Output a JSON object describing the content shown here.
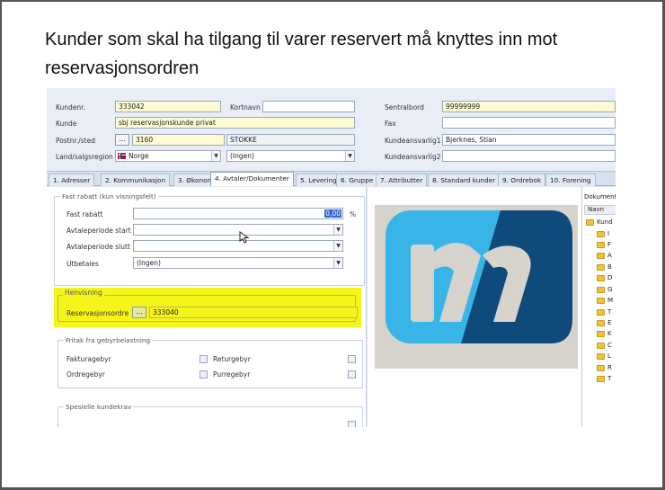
{
  "slide": {
    "title": "Kunder som skal ha tilgang til varer reservert må knyttes inn mot reservasjonsordren"
  },
  "form": {
    "kundenr_label": "Kundenr.",
    "kundenr_value": "333042",
    "kortnavn_label": "Kortnavn",
    "kortnavn_value": "",
    "kunde_label": "Kunde",
    "kunde_value": "sbj reservasjonskunde privat",
    "postnr_label": "Postnr./sted",
    "postnr_button": "...",
    "postnr_value": "3160",
    "sted_value": "STOKKE",
    "land_label": "Land/salgsregion",
    "land_value": "Norge",
    "region_value": "(Ingen)",
    "sentralbord_label": "Sentralbord",
    "sentralbord_value": "99999999",
    "fax_label": "Fax",
    "fax_value": "",
    "kundeansvarlig1_label": "Kundeansvarlig1",
    "kundeansvarlig1_value": "Bjerknes, Stian",
    "kundeansvarlig2_label": "Kundeansvarlig2",
    "kundeansvarlig2_value": ""
  },
  "tabs": [
    {
      "label": "1. Adresser"
    },
    {
      "label": "2. Kommunikasjon"
    },
    {
      "label": "3. Økonomi"
    },
    {
      "label": "4. Avtaler/Dokumenter"
    },
    {
      "label": "5. Levering"
    },
    {
      "label": "6. Gruppe"
    },
    {
      "label": "7. Attributter"
    },
    {
      "label": "8. Standard kunder"
    },
    {
      "label": "9. Ordrebok"
    },
    {
      "label": "10. Forening"
    }
  ],
  "fast_rabatt": {
    "group_title": "Fast rabatt (kun visningsfelt)",
    "rabatt_label": "Fast rabatt",
    "rabatt_value": "0,00",
    "percent": "%",
    "start_label": "Avtaleperiode start",
    "slutt_label": "Avtaleperiode slutt",
    "utbetales_label": "Utbetales",
    "utbetales_value": "(Ingen)"
  },
  "henvisning": {
    "group_title": "Henvisning",
    "reservasjon_label": "Reservasjonsordre",
    "reservasjon_button": "...",
    "reservasjon_value": "333040"
  },
  "fritak": {
    "group_title": "Fritak fra gebyrbelastning",
    "faktura_label": "Fakturagebyr",
    "retur_label": "Returgebyr",
    "ordre_label": "Ordregebyr",
    "purre_label": "Purregebyr"
  },
  "spesielle": {
    "group_title": "Spesielle kundekrav"
  },
  "documents": {
    "title": "Dokument",
    "column": "Navn",
    "root": "Kund",
    "folders": [
      "I",
      "F",
      "A",
      "B",
      "D",
      "G",
      "M",
      "T",
      "E",
      "K",
      "C",
      "L",
      "R",
      "T"
    ]
  },
  "colors": {
    "highlight": "#f5f51a",
    "required_field": "#fdfbd2",
    "logo_light_blue": "#39b4e6",
    "logo_dark_blue": "#0e4a7a"
  }
}
